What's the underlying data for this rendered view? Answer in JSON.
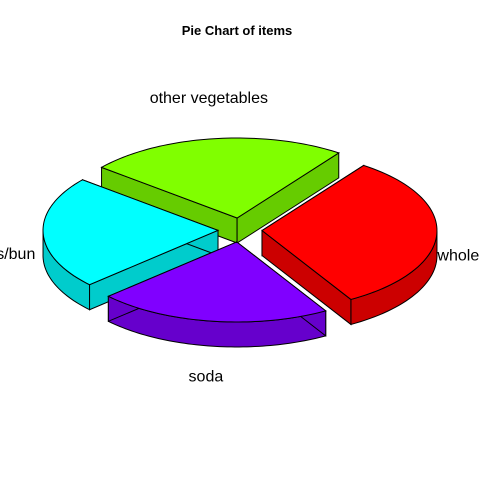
{
  "chart_data": {
    "type": "pie",
    "style": "3d-exploded",
    "title": "Pie Chart of items",
    "slices": [
      {
        "label": "whole milk",
        "value": 2513,
        "color": "#FF0000",
        "side_color": "#CC0000"
      },
      {
        "label": "soda",
        "value": 1715,
        "color": "#8000FF",
        "side_color": "#6600CC"
      },
      {
        "label": "rolls/bun",
        "value": 1809,
        "color": "#00FFFF",
        "side_color": "#00CCCC"
      },
      {
        "label": "other vegetables",
        "value": 1903,
        "color": "#80FF00",
        "side_color": "#66CC00"
      }
    ]
  }
}
